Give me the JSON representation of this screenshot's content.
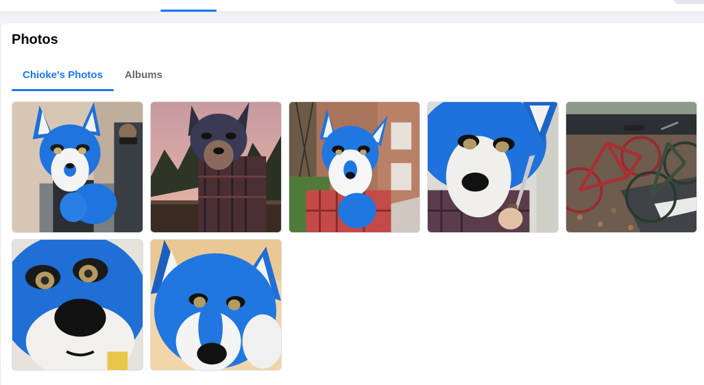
{
  "card": {
    "title": "Photos"
  },
  "tabs": [
    {
      "label": "Chioke's Photos",
      "active": true
    },
    {
      "label": "Albums",
      "active": false
    }
  ],
  "colors": {
    "accent": "#1877f2",
    "text_primary": "#050505",
    "text_secondary": "#65676b"
  },
  "photos": [
    {
      "subject": "blue fursuit with companion"
    },
    {
      "subject": "fursuit at sunset"
    },
    {
      "subject": "blue fursuit outside brick building"
    },
    {
      "subject": "blue fursuit close-up holding knife"
    },
    {
      "subject": "bicycles on leaves"
    },
    {
      "subject": "blue fursuit face close-up"
    },
    {
      "subject": "blue fursuit head close-up"
    }
  ]
}
